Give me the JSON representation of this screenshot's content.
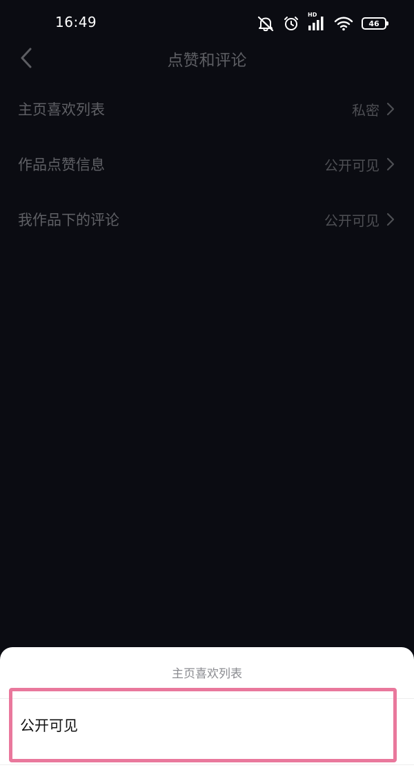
{
  "status_bar": {
    "time": "16:49",
    "network_label": "HD",
    "battery_level": "46",
    "icons": [
      "mute-bell-icon",
      "alarm-icon",
      "signal-icon",
      "wifi-icon",
      "battery-icon"
    ]
  },
  "nav": {
    "back_icon": "chevron-left-icon",
    "title": "点赞和评论"
  },
  "settings": {
    "items": [
      {
        "label": "主页喜欢列表",
        "value": "私密",
        "icon": "chevron-right-icon"
      },
      {
        "label": "作品点赞信息",
        "value": "公开可见",
        "icon": "chevron-right-icon"
      },
      {
        "label": "我作品下的评论",
        "value": "公开可见",
        "icon": "chevron-right-icon"
      }
    ]
  },
  "sheet": {
    "title": "主页喜欢列表",
    "options": [
      {
        "label": "公开可见",
        "highlighted": true
      }
    ]
  },
  "colors": {
    "background": "#0b0c12",
    "sheet_background": "#ffffff",
    "highlight_border": "#e9789c"
  }
}
